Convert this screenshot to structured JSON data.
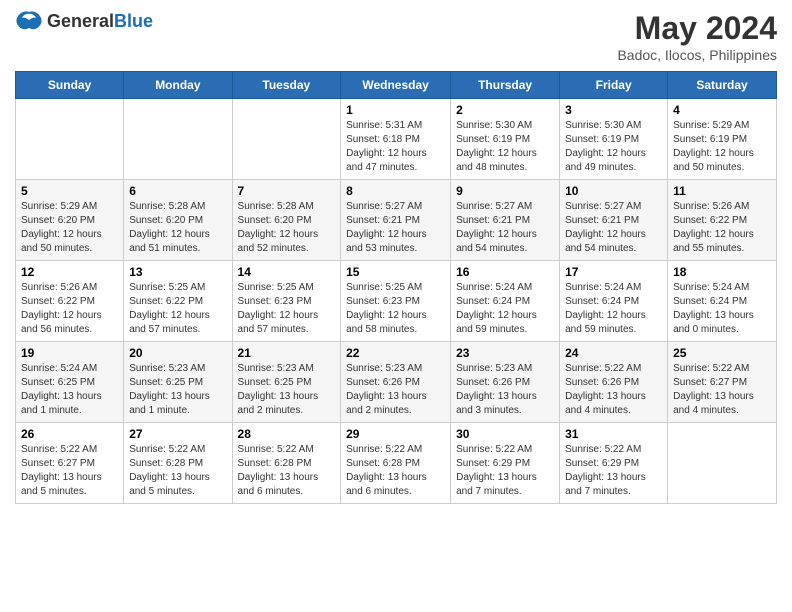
{
  "logo": {
    "text_general": "General",
    "text_blue": "Blue"
  },
  "header": {
    "title": "May 2024",
    "subtitle": "Badoc, Ilocos, Philippines"
  },
  "calendar": {
    "weekdays": [
      "Sunday",
      "Monday",
      "Tuesday",
      "Wednesday",
      "Thursday",
      "Friday",
      "Saturday"
    ],
    "weeks": [
      [
        {
          "day": "",
          "info": ""
        },
        {
          "day": "",
          "info": ""
        },
        {
          "day": "",
          "info": ""
        },
        {
          "day": "1",
          "info": "Sunrise: 5:31 AM\nSunset: 6:18 PM\nDaylight: 12 hours\nand 47 minutes."
        },
        {
          "day": "2",
          "info": "Sunrise: 5:30 AM\nSunset: 6:19 PM\nDaylight: 12 hours\nand 48 minutes."
        },
        {
          "day": "3",
          "info": "Sunrise: 5:30 AM\nSunset: 6:19 PM\nDaylight: 12 hours\nand 49 minutes."
        },
        {
          "day": "4",
          "info": "Sunrise: 5:29 AM\nSunset: 6:19 PM\nDaylight: 12 hours\nand 50 minutes."
        }
      ],
      [
        {
          "day": "5",
          "info": "Sunrise: 5:29 AM\nSunset: 6:20 PM\nDaylight: 12 hours\nand 50 minutes."
        },
        {
          "day": "6",
          "info": "Sunrise: 5:28 AM\nSunset: 6:20 PM\nDaylight: 12 hours\nand 51 minutes."
        },
        {
          "day": "7",
          "info": "Sunrise: 5:28 AM\nSunset: 6:20 PM\nDaylight: 12 hours\nand 52 minutes."
        },
        {
          "day": "8",
          "info": "Sunrise: 5:27 AM\nSunset: 6:21 PM\nDaylight: 12 hours\nand 53 minutes."
        },
        {
          "day": "9",
          "info": "Sunrise: 5:27 AM\nSunset: 6:21 PM\nDaylight: 12 hours\nand 54 minutes."
        },
        {
          "day": "10",
          "info": "Sunrise: 5:27 AM\nSunset: 6:21 PM\nDaylight: 12 hours\nand 54 minutes."
        },
        {
          "day": "11",
          "info": "Sunrise: 5:26 AM\nSunset: 6:22 PM\nDaylight: 12 hours\nand 55 minutes."
        }
      ],
      [
        {
          "day": "12",
          "info": "Sunrise: 5:26 AM\nSunset: 6:22 PM\nDaylight: 12 hours\nand 56 minutes."
        },
        {
          "day": "13",
          "info": "Sunrise: 5:25 AM\nSunset: 6:22 PM\nDaylight: 12 hours\nand 57 minutes."
        },
        {
          "day": "14",
          "info": "Sunrise: 5:25 AM\nSunset: 6:23 PM\nDaylight: 12 hours\nand 57 minutes."
        },
        {
          "day": "15",
          "info": "Sunrise: 5:25 AM\nSunset: 6:23 PM\nDaylight: 12 hours\nand 58 minutes."
        },
        {
          "day": "16",
          "info": "Sunrise: 5:24 AM\nSunset: 6:24 PM\nDaylight: 12 hours\nand 59 minutes."
        },
        {
          "day": "17",
          "info": "Sunrise: 5:24 AM\nSunset: 6:24 PM\nDaylight: 12 hours\nand 59 minutes."
        },
        {
          "day": "18",
          "info": "Sunrise: 5:24 AM\nSunset: 6:24 PM\nDaylight: 13 hours\nand 0 minutes."
        }
      ],
      [
        {
          "day": "19",
          "info": "Sunrise: 5:24 AM\nSunset: 6:25 PM\nDaylight: 13 hours\nand 1 minute."
        },
        {
          "day": "20",
          "info": "Sunrise: 5:23 AM\nSunset: 6:25 PM\nDaylight: 13 hours\nand 1 minute."
        },
        {
          "day": "21",
          "info": "Sunrise: 5:23 AM\nSunset: 6:25 PM\nDaylight: 13 hours\nand 2 minutes."
        },
        {
          "day": "22",
          "info": "Sunrise: 5:23 AM\nSunset: 6:26 PM\nDaylight: 13 hours\nand 2 minutes."
        },
        {
          "day": "23",
          "info": "Sunrise: 5:23 AM\nSunset: 6:26 PM\nDaylight: 13 hours\nand 3 minutes."
        },
        {
          "day": "24",
          "info": "Sunrise: 5:22 AM\nSunset: 6:26 PM\nDaylight: 13 hours\nand 4 minutes."
        },
        {
          "day": "25",
          "info": "Sunrise: 5:22 AM\nSunset: 6:27 PM\nDaylight: 13 hours\nand 4 minutes."
        }
      ],
      [
        {
          "day": "26",
          "info": "Sunrise: 5:22 AM\nSunset: 6:27 PM\nDaylight: 13 hours\nand 5 minutes."
        },
        {
          "day": "27",
          "info": "Sunrise: 5:22 AM\nSunset: 6:28 PM\nDaylight: 13 hours\nand 5 minutes."
        },
        {
          "day": "28",
          "info": "Sunrise: 5:22 AM\nSunset: 6:28 PM\nDaylight: 13 hours\nand 6 minutes."
        },
        {
          "day": "29",
          "info": "Sunrise: 5:22 AM\nSunset: 6:28 PM\nDaylight: 13 hours\nand 6 minutes."
        },
        {
          "day": "30",
          "info": "Sunrise: 5:22 AM\nSunset: 6:29 PM\nDaylight: 13 hours\nand 7 minutes."
        },
        {
          "day": "31",
          "info": "Sunrise: 5:22 AM\nSunset: 6:29 PM\nDaylight: 13 hours\nand 7 minutes."
        },
        {
          "day": "",
          "info": ""
        }
      ]
    ]
  }
}
